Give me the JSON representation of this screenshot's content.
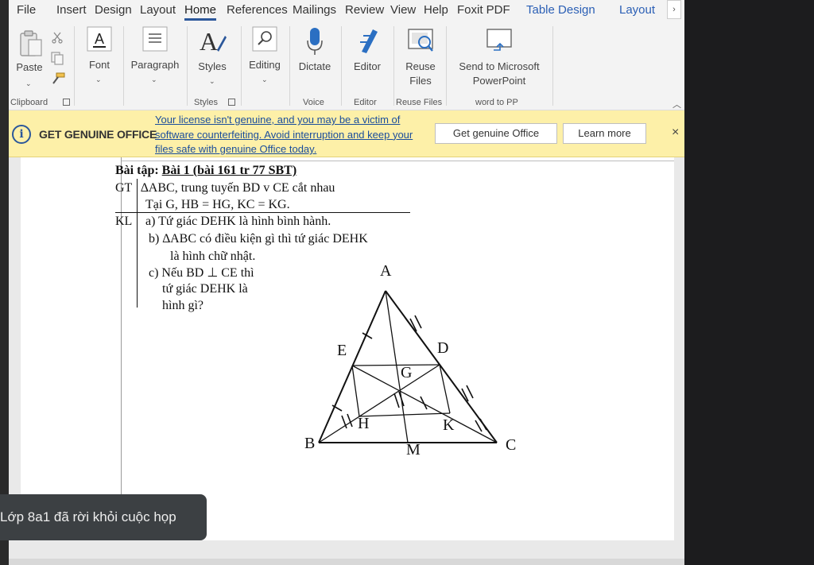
{
  "menu": {
    "tabs": [
      "File",
      "Insert",
      "Design",
      "Layout",
      "Home",
      "References",
      "Mailings",
      "Review",
      "View",
      "Help",
      "Foxit PDF"
    ],
    "contextual": [
      "Table Design",
      "Layout"
    ],
    "more": "›"
  },
  "ribbon": {
    "paste": "Paste",
    "font": "Font",
    "paragraph": "Paragraph",
    "styles": "Styles",
    "editing": "Editing",
    "dictate": "Dictate",
    "editor": "Editor",
    "reuse_files_1": "Reuse",
    "reuse_files_2": "Files",
    "send_ppt_1": "Send to Microsoft",
    "send_ppt_2": "PowerPoint",
    "groups": {
      "clipboard": "Clipboard",
      "styles": "Styles",
      "voice": "Voice",
      "editor": "Editor",
      "reuse_files": "Reuse Files",
      "word_to_pp": "word to PP"
    }
  },
  "banner": {
    "title": "GET GENUINE OFFICE",
    "message": "Your license isn't genuine, and you may be a victim of software counterfeiting. Avoid interruption and keep your files safe with genuine Office today.",
    "get_genuine": "Get genuine Office",
    "learn_more": "Learn more",
    "close": "×"
  },
  "document": {
    "title_prefix": "Bài tập:",
    "title_main": "Bài 1 (bài 161 tr 77 SBT)",
    "gt_label": "GT",
    "gt_line1": "∆ABC, trung tuyến BD v CE cắt nhau",
    "gt_line2": "Tại G, HB = HG, KC = KG.",
    "kl_label": "KL",
    "kl_a": "a) Tứ giác DEHK là hình bình hành.",
    "kl_b1": "b)  ∆ABC có điều kiện gì thì tứ giác DEHK",
    "kl_b2": "là hình chữ nhật.",
    "kl_c1": "c) Nếu BD ⊥ CE thì",
    "kl_c2": "tứ giác DEHK là",
    "kl_c3": "hình gì?"
  },
  "figure": {
    "labels": {
      "A": "A",
      "B": "B",
      "C": "C",
      "D": "D",
      "E": "E",
      "G": "G",
      "H": "H",
      "K": "K",
      "M": "M"
    }
  },
  "toast": {
    "text": "Lớp 8a1 đã rời khỏi cuộc họp"
  },
  "colors": {
    "accent": "#2b579a",
    "banner_bg": "#fdf0a8",
    "banner_link": "#1a4d9c",
    "contextual_tab": "#2b5fb5"
  }
}
